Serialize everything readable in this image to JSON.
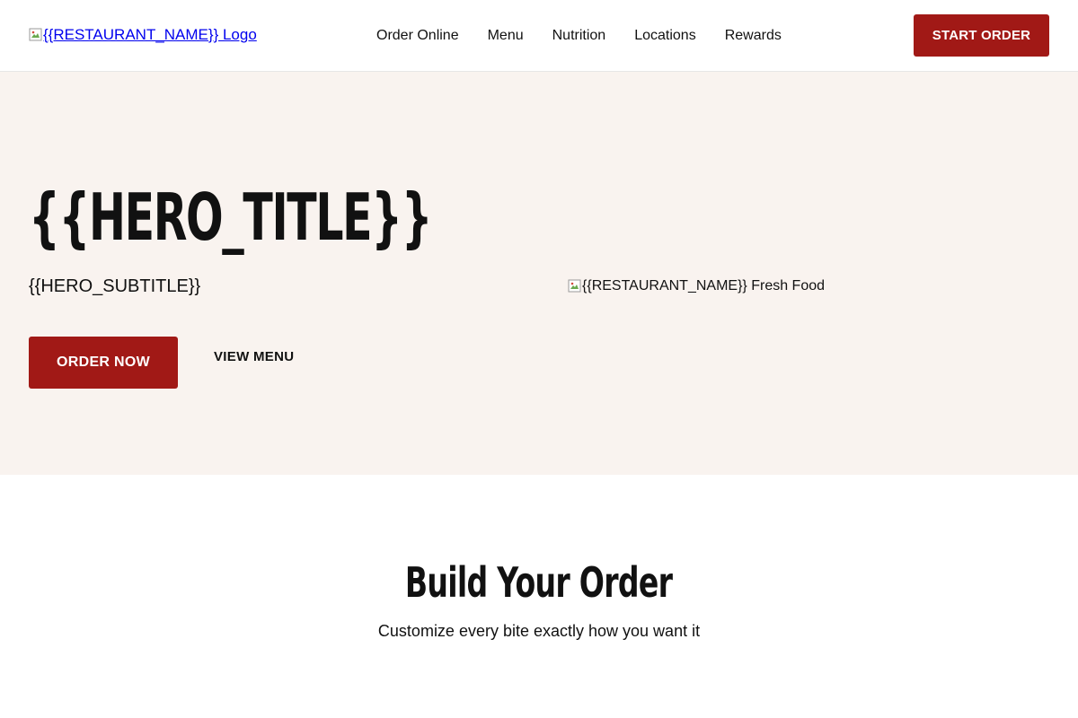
{
  "header": {
    "logo_alt": "{{RESTAURANT_NAME}} Logo",
    "nav": [
      {
        "label": "Order Online"
      },
      {
        "label": "Menu"
      },
      {
        "label": "Nutrition"
      },
      {
        "label": "Locations"
      },
      {
        "label": "Rewards"
      }
    ],
    "cta_label": "START ORDER"
  },
  "hero": {
    "title": "{{HERO_TITLE}}",
    "subtitle": "{{HERO_SUBTITLE}}",
    "primary_button": "ORDER NOW",
    "secondary_link": "VIEW MENU",
    "image_alt": "{{RESTAURANT_NAME}} Fresh Food"
  },
  "build_section": {
    "title": "Build Your Order",
    "subtitle": "Customize every bite exactly how you want it"
  },
  "colors": {
    "brand_red": "#a11916",
    "hero_background": "#f9f3ef",
    "link_blue": "#0000ee"
  },
  "icons": {
    "logo": "broken-image-icon",
    "hero_image": "broken-image-icon"
  }
}
